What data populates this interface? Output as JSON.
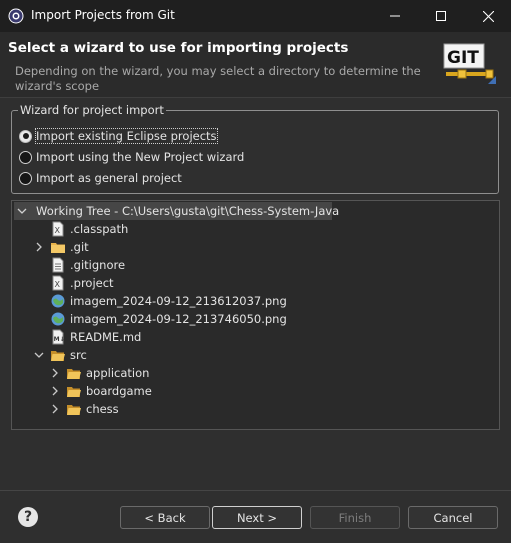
{
  "window": {
    "title": "Import Projects from Git",
    "controls": {
      "minimize": "—",
      "maximize": "☐",
      "close": "✕"
    }
  },
  "header": {
    "title": "Select a wizard to use for importing projects",
    "description": "Depending on the wizard, you may select a directory to determine the wizard's scope",
    "logo_text": "GIT"
  },
  "wizard_group": {
    "legend": "Wizard for project import",
    "options": [
      {
        "label": "Import existing Eclipse projects",
        "selected": true
      },
      {
        "label": "Import using the New Project wizard",
        "selected": false
      },
      {
        "label": "Import as general project",
        "selected": false
      }
    ]
  },
  "tree": {
    "root": "Working Tree - C:\\Users\\gusta\\git\\Chess-System-Java",
    "items": [
      {
        "label": ".classpath",
        "icon": "xml-file-icon"
      },
      {
        "label": ".git",
        "icon": "folder-icon"
      },
      {
        "label": ".gitignore",
        "icon": "text-file-icon"
      },
      {
        "label": ".project",
        "icon": "xml-file-icon"
      },
      {
        "label": "imagem_2024-09-12_213612037.png",
        "icon": "image-file-icon"
      },
      {
        "label": "imagem_2024-09-12_213746050.png",
        "icon": "image-file-icon"
      },
      {
        "label": "README.md",
        "icon": "markdown-file-icon"
      },
      {
        "label": "src",
        "icon": "folder-icon"
      },
      {
        "label": "application",
        "icon": "folder-icon"
      },
      {
        "label": "boardgame",
        "icon": "folder-icon"
      },
      {
        "label": "chess",
        "icon": "folder-icon"
      }
    ]
  },
  "footer": {
    "help": "?",
    "back_label": "< Back",
    "next_label": "Next >",
    "finish_label": "Finish",
    "cancel_label": "Cancel"
  },
  "colors": {
    "folder": "#e8b24a",
    "background": "#2f2f2f",
    "tree_background": "#2a2a2a",
    "selection": "#464646"
  }
}
